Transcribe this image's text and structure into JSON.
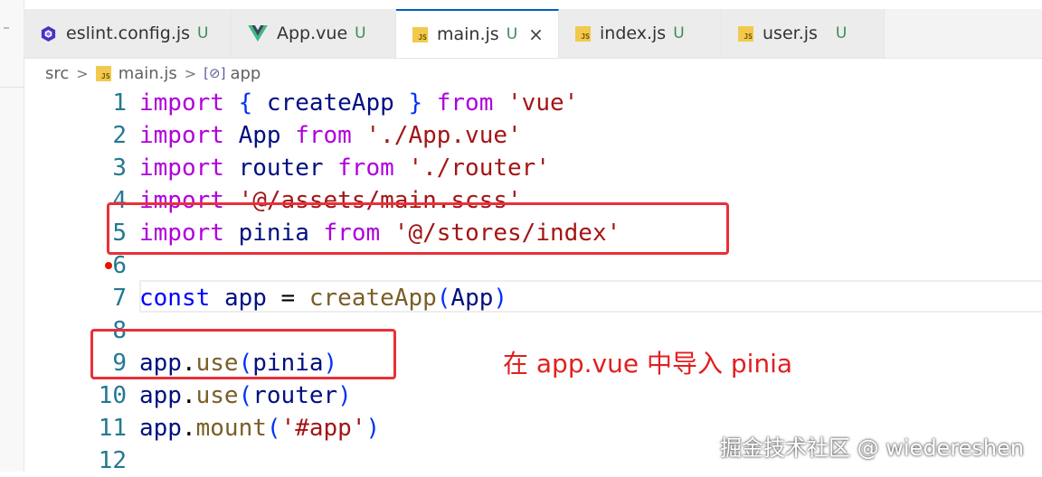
{
  "tabs": [
    {
      "name": "eslint.config.js",
      "status": "U",
      "icon": "eslint-icon",
      "active": false
    },
    {
      "name": "App.vue",
      "status": "U",
      "icon": "vue-icon",
      "active": false
    },
    {
      "name": "main.js",
      "status": "U",
      "icon": "js-icon",
      "active": true,
      "close": "×"
    },
    {
      "name": "index.js",
      "status": "U",
      "icon": "js-icon",
      "active": false
    },
    {
      "name": "user.js",
      "status": "U",
      "icon": "js-icon",
      "active": false
    }
  ],
  "js_badge": "JS",
  "breadcrumb": {
    "folder": "src",
    "file": "main.js",
    "symbol": "app",
    "symbol_icon": "[⊘]"
  },
  "lines": [
    {
      "num": "1",
      "text": "import { createApp } from 'vue'"
    },
    {
      "num": "2",
      "text": "import App from './App.vue'"
    },
    {
      "num": "3",
      "text": "import router from './router'"
    },
    {
      "num": "4",
      "text": "import '@/assets/main.scss'"
    },
    {
      "num": "5",
      "text": "import pinia from '@/stores/index'"
    },
    {
      "num": "6",
      "text": ""
    },
    {
      "num": "7",
      "text": "const app = createApp(App)"
    },
    {
      "num": "8",
      "text": ""
    },
    {
      "num": "9",
      "text": "app.use(pinia)"
    },
    {
      "num": "10",
      "text": "app.use(router)"
    },
    {
      "num": "11",
      "text": "app.mount('#app')"
    },
    {
      "num": "12",
      "text": ""
    }
  ],
  "annotation": "在 app.vue 中导入 pinia",
  "watermark": "掘金技术社区 @ wiedereshen",
  "colors": {
    "accent": "#005fb8",
    "annotation_red": "#e8303a",
    "untracked_green": "#3c8c5a"
  }
}
